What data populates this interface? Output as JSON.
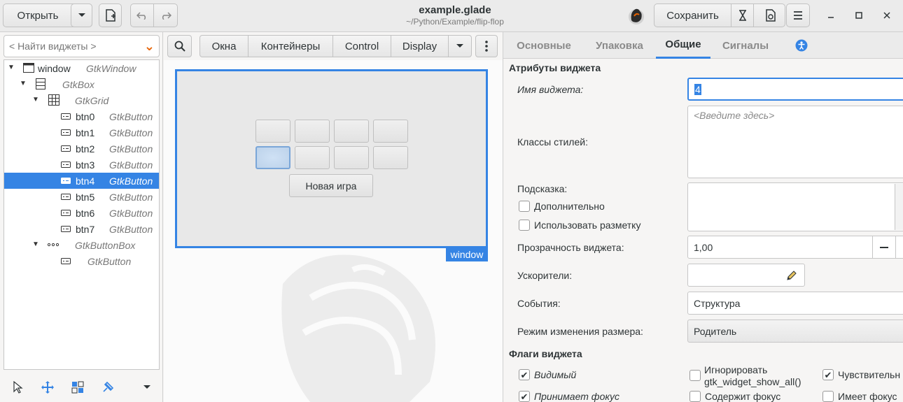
{
  "header": {
    "open_label": "Открыть",
    "title": "example.glade",
    "subtitle": "~/Python/Example/flip-flop",
    "save_label": "Сохранить"
  },
  "left": {
    "search_placeholder": "< Найти виджеты >",
    "tree": [
      {
        "name": "window",
        "type": "GtkWindow"
      },
      {
        "name": "",
        "type": "GtkBox"
      },
      {
        "name": "",
        "type": "GtkGrid"
      },
      {
        "name": "btn0",
        "type": "GtkButton"
      },
      {
        "name": "btn1",
        "type": "GtkButton"
      },
      {
        "name": "btn2",
        "type": "GtkButton"
      },
      {
        "name": "btn3",
        "type": "GtkButton"
      },
      {
        "name": "btn4",
        "type": "GtkButton"
      },
      {
        "name": "btn5",
        "type": "GtkButton"
      },
      {
        "name": "btn6",
        "type": "GtkButton"
      },
      {
        "name": "btn7",
        "type": "GtkButton"
      },
      {
        "name": "",
        "type": "GtkButtonBox"
      },
      {
        "name": "",
        "type": "GtkButton"
      }
    ]
  },
  "center": {
    "toolbar": [
      "Окна",
      "Контейнеры",
      "Control",
      "Display"
    ],
    "new_game_label": "Новая игра",
    "window_tag": "window"
  },
  "right": {
    "tabs": [
      "Основные",
      "Упаковка",
      "Общие",
      "Сигналы"
    ],
    "attrs_title": "Атрибуты виджета",
    "widget_name_label": "Имя виджета:",
    "widget_name_value": "4",
    "style_classes_label": "Классы стилей:",
    "style_placeholder": "<Введите здесь>",
    "tooltip_label": "Подсказка:",
    "extra_label": "Дополнительно",
    "markup_label": "Использовать разметку",
    "opacity_label": "Прозрачность виджета:",
    "opacity_value": "1,00",
    "accel_label": "Ускорители:",
    "events_label": "События:",
    "events_value": "Структура",
    "resize_label": "Режим изменения размера:",
    "resize_value": "Родитель",
    "flags_title": "Флаги виджета",
    "visible_label": "Видимый",
    "ignore_label_1": "Игнорировать",
    "ignore_label_2": "gtk_widget_show_all()",
    "sensitive_label": "Чувствительн",
    "focus_label": "Принимает фокус",
    "has_focus_label": "Содержит фокус",
    "is_focus_label": "Имеет фокус"
  }
}
